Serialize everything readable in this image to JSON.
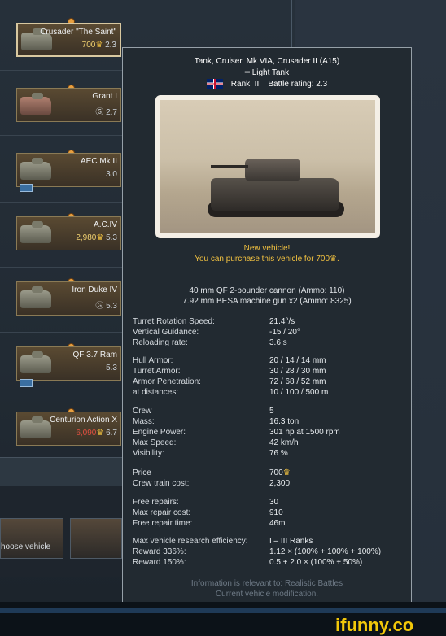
{
  "tanks": [
    {
      "name": "Crusader \"The Saint\"",
      "price": "700",
      "br": "2.3",
      "selected": true
    },
    {
      "name": "Grant I",
      "price": "",
      "br": "2.7"
    },
    {
      "name": "AEC Mk II",
      "price": "",
      "br": "3.0"
    },
    {
      "name": "A.C.IV",
      "price": "2,980",
      "br": "5.3"
    },
    {
      "name": "Iron Duke IV",
      "price": "",
      "br": "5.3"
    },
    {
      "name": "QF 3.7 Ram",
      "price": "",
      "br": "5.3"
    },
    {
      "name": "Centurion Action X",
      "price": "6,090",
      "br": "6.7"
    }
  ],
  "bottom": {
    "choose_vehicle": "hoose vehicle"
  },
  "tooltip": {
    "title": "Tank, Cruiser, Mk VIA, Crusader II (A15)",
    "class": "Light Tank",
    "rank": "Rank: II",
    "battle_rating": "Battle rating: 2.3",
    "new_vehicle": "New vehicle!",
    "purchase_text": "You can purchase this vehicle for 700",
    "weapon1": "40 mm QF 2-pounder cannon (Ammo: 110)",
    "weapon2": "7.92 mm BESA machine gun x2 (Ammo: 8325)",
    "stats": [
      {
        "k": "Turret Rotation Speed:",
        "v": "21.4°/s"
      },
      {
        "k": "Vertical Guidance:",
        "v": "-15 / 20°"
      },
      {
        "k": "Reloading rate:",
        "v": "3.6 s"
      },
      {
        "k": "Hull Armor:",
        "v": "20 / 14 / 14 mm"
      },
      {
        "k": "Turret Armor:",
        "v": "30 / 28 / 30 mm"
      },
      {
        "k": "Armor Penetration:",
        "v": "72 / 68 / 52 mm"
      },
      {
        "k": "at distances:",
        "v": "10 / 100 / 500 m"
      },
      {
        "k": "Crew",
        "v": "5"
      },
      {
        "k": "Mass:",
        "v": "16.3 ton"
      },
      {
        "k": "Engine Power:",
        "v": "301 hp at 1500 rpm"
      },
      {
        "k": "Max Speed:",
        "v": "42 km/h"
      },
      {
        "k": "Visibility:",
        "v": "76 %"
      },
      {
        "k": "Price",
        "v": "700"
      },
      {
        "k": "Crew train cost:",
        "v": "2,300"
      },
      {
        "k": "Free repairs:",
        "v": "30"
      },
      {
        "k": "Max repair cost:",
        "v": "910"
      },
      {
        "k": "Free repair time:",
        "v": "46m"
      },
      {
        "k": "Max vehicle research efficiency:",
        "v": "I – III Ranks"
      },
      {
        "k": "Reward 336%:",
        "v": "1.12 × (100% + 100% + 100%)"
      },
      {
        "k": "Reward 150%:",
        "v": "0.5 + 2.0 × (100% + 50%)"
      }
    ],
    "footer1": "Information is relevant to: Realistic Battles",
    "footer2": "Current vehicle modification."
  },
  "watermark": "ifunny.co"
}
